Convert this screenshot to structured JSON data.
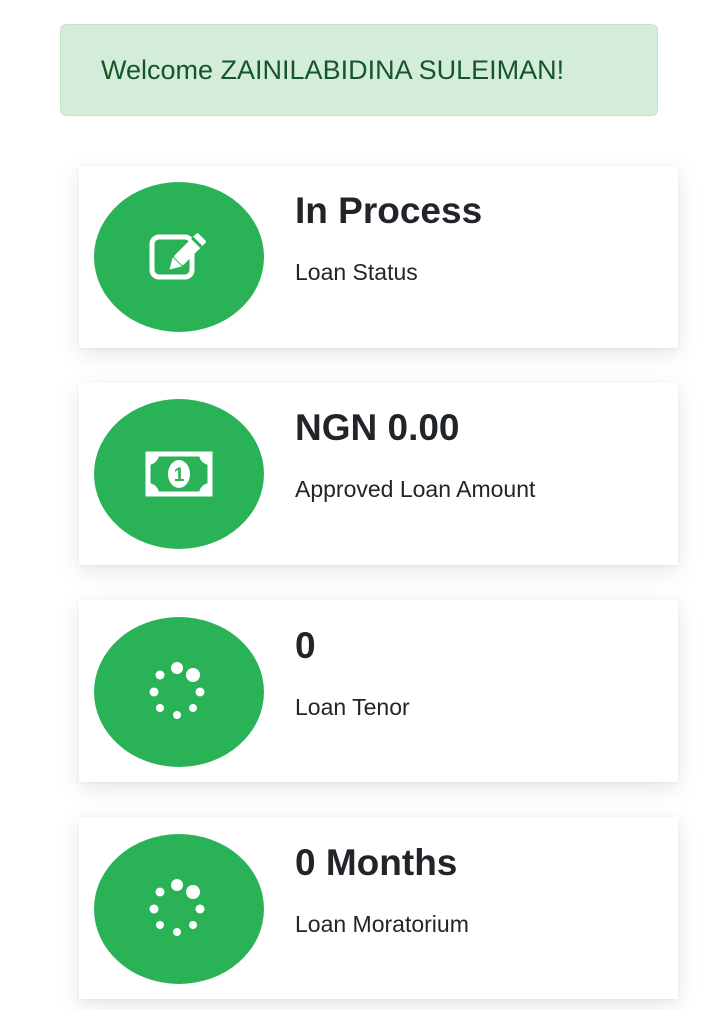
{
  "welcome": {
    "text": "Welcome ZAINILABIDINA SULEIMAN!"
  },
  "cards": [
    {
      "value": "In Process",
      "label": "Loan Status",
      "icon": "edit-icon"
    },
    {
      "value": "NGN 0.00",
      "label": "Approved Loan Amount",
      "icon": "money-bill-icon"
    },
    {
      "value": "0",
      "label": "Loan Tenor",
      "icon": "spinner-icon"
    },
    {
      "value": "0 Months",
      "label": "Loan Moratorium",
      "icon": "spinner-icon"
    }
  ],
  "colors": {
    "accent": "#2ab257",
    "alert_bg": "#d4eddb",
    "alert_text": "#155724"
  }
}
